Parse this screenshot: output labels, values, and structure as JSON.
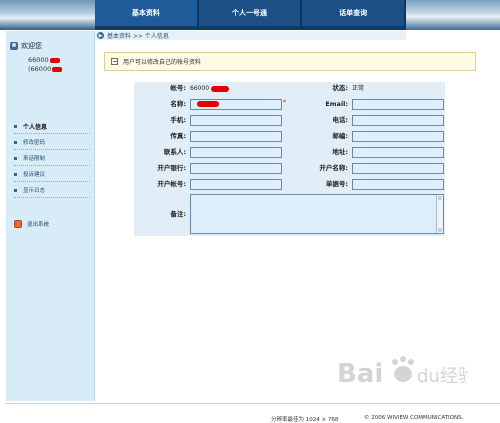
{
  "tabs": [
    {
      "label": "基本资料",
      "active": true
    },
    {
      "label": "个人一号通",
      "active": false
    },
    {
      "label": "话单查询",
      "active": false
    }
  ],
  "sidebar": {
    "welcome": "欢迎您",
    "accounts": [
      "66000",
      "(66000"
    ],
    "menu": [
      {
        "label": "个人信息",
        "head": true
      },
      {
        "label": "修改密码"
      },
      {
        "label": "来话限制"
      },
      {
        "label": "投诉建议"
      },
      {
        "label": "显示日志"
      }
    ],
    "logout": "退出系统"
  },
  "breadcrumb": "基本资料 >> 个人信息",
  "notice": "用户可以修改自己的帐号资料",
  "form": {
    "account_label": "帐号:",
    "account_value": "66000",
    "status_label": "状态:",
    "status_value": "正常",
    "name_label": "名称:",
    "email_label": "Email:",
    "mobile_label": "手机:",
    "phone_label": "电话:",
    "fax_label": "传真:",
    "zip_label": "邮编:",
    "contact_label": "联系人:",
    "address_label": "地址:",
    "bank_label": "开户银行:",
    "account_name_label": "开户名称:",
    "bank_account_label": "开户帐号:",
    "receipt_label": "单据号:",
    "remark_label": "备注:",
    "required_mark": "*"
  },
  "footer": {
    "resolution": "分辨率最佳为 1024 × 768",
    "copyright": "© 2006 WIVIEW COMMUNICATIONS."
  },
  "watermark": "Baidu 经验",
  "colors": {
    "tab_bg": "#1b4f86",
    "sidebar_bg": "#d8ecf7",
    "form_bg": "#e1eef7"
  }
}
